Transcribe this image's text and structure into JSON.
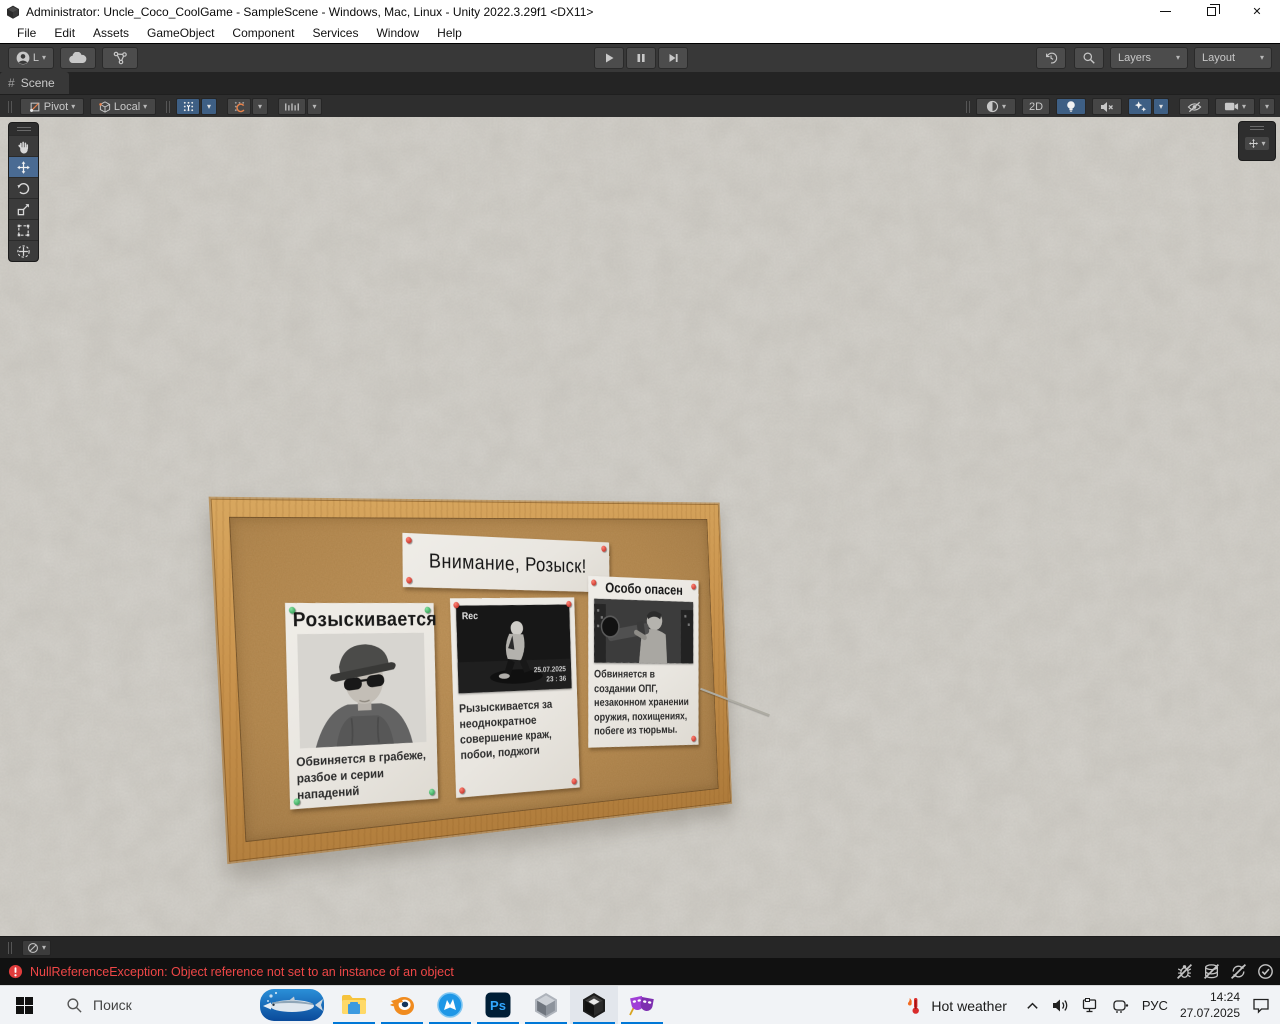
{
  "glyphs": {
    "caret": "▾",
    "close": "✕",
    "hash": "#"
  },
  "titlebar": {
    "title": "Administrator: Uncle_Coco_CoolGame - SampleScene - Windows, Mac, Linux - Unity 2022.3.29f1 <DX11>"
  },
  "menu": {
    "items": [
      "File",
      "Edit",
      "Assets",
      "GameObject",
      "Component",
      "Services",
      "Window",
      "Help"
    ]
  },
  "toolbar": {
    "account_initial": "L",
    "layers": "Layers",
    "layout": "Layout"
  },
  "scene": {
    "tab": "Scene",
    "pivot": "Pivot",
    "local": "Local",
    "mode2d": "2D"
  },
  "board": {
    "header": "Внимание, Розыск!",
    "poster_left": {
      "title": "Розыскивается",
      "desc": "Обвиняется в грабеже, разбое и серии нападений"
    },
    "poster_middle": {
      "rec": "Rec",
      "date": "25.07.2025",
      "time": "23 : 36",
      "desc": "Рызыскивается за неоднократное совершение краж, побои, поджоги"
    },
    "poster_right": {
      "title": "Особо опасен",
      "desc": "Обвиняется в создании ОПГ, незаконном хранении оружия, похищениях, побеге из тюрьмы."
    }
  },
  "statusbar": {
    "error": "NullReferenceException: Object reference not set to an instance of an object"
  },
  "taskbar": {
    "search": "Поиск",
    "photoshop_label": "Ps",
    "tray": {
      "weather": "Hot weather",
      "language": "РУС",
      "time": "14:24",
      "date": "27.07.2025"
    }
  },
  "colors": {
    "accent_blue": "#3e5f84",
    "underline_blue": "#0078d7",
    "error_red": "#ef4747",
    "cork": "#b0834a",
    "wood": "#c8924c",
    "pin_red": "#b61f17",
    "pin_green": "#1f8f45"
  }
}
